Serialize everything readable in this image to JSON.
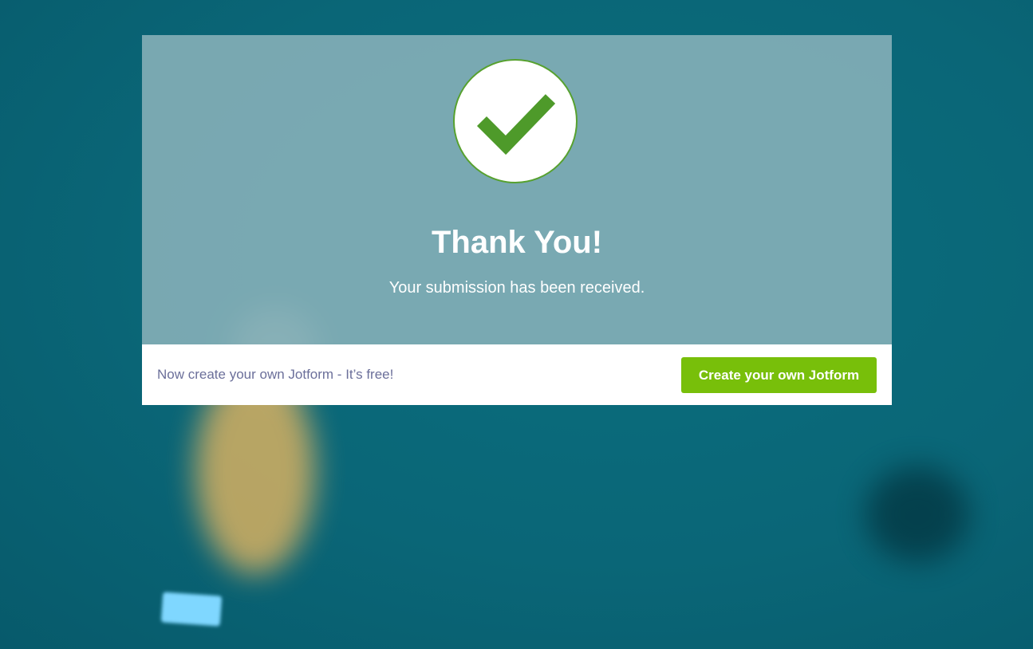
{
  "background": {
    "color": "#0a6677"
  },
  "confirmation": {
    "icon": "checkmark-icon",
    "title": "Thank You!",
    "message": "Your submission has been received.",
    "accent_color": "#57a12f"
  },
  "footer": {
    "promo_text": "Now create your own Jotform - It’s free!",
    "button_label": "Create your own Jotform",
    "button_color": "#78bf0a"
  }
}
